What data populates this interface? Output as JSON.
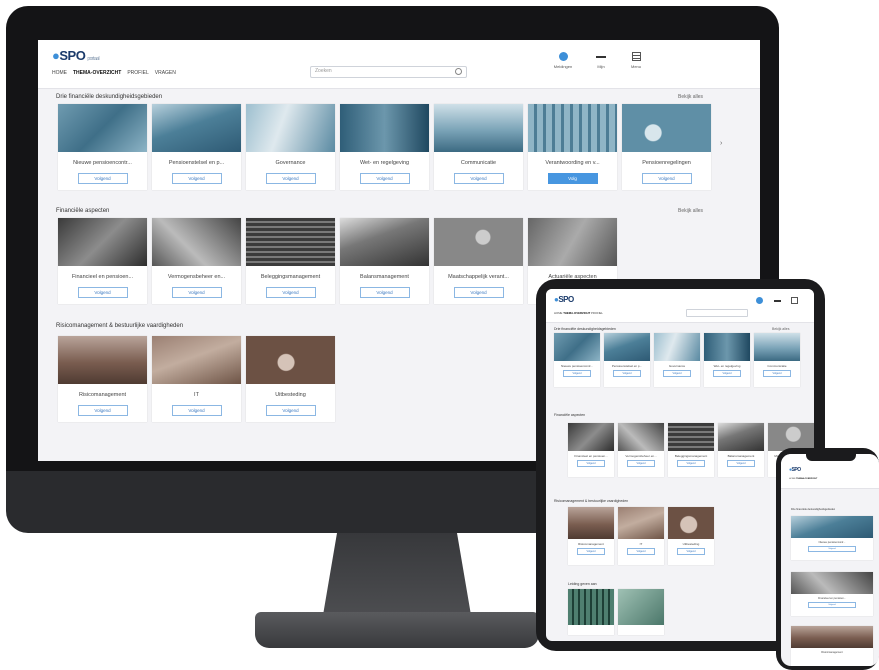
{
  "app": {
    "logo_text": "SPO",
    "logo_sub": "portaal"
  },
  "nav": [
    "HOME",
    "THEMA-OVERZICHT",
    "PROFIEL",
    "VRAGEN"
  ],
  "search": {
    "placeholder": "Zoeken"
  },
  "toolbar": {
    "notifications_label": "Meldingen",
    "profile_label": "Mijn",
    "menu_label": "Menu"
  },
  "sections": [
    {
      "title": "Drie financiële deskundigheidsgebieden",
      "more": "Bekijk alles",
      "cards": [
        {
          "caption": "Nieuwe pensioencontr...",
          "button": "Volgend"
        },
        {
          "caption": "Pensioenstelsel en p...",
          "button": "Volgend"
        },
        {
          "caption": "Governance",
          "button": "Volgend"
        },
        {
          "caption": "Wet- en regelgeving",
          "button": "Volgend"
        },
        {
          "caption": "Communicatie",
          "button": "Volgend"
        },
        {
          "caption": "Verantwoording en v...",
          "button": "Volg"
        },
        {
          "caption": "Pensioenregelingen",
          "button": "Volgend"
        }
      ]
    },
    {
      "title": "Financiële aspecten",
      "more": "Bekijk alles",
      "cards": [
        {
          "caption": "Financieel en pensioen...",
          "button": "Volgend"
        },
        {
          "caption": "Vermogensbeheer en...",
          "button": "Volgend"
        },
        {
          "caption": "Beleggingsmanagement",
          "button": "Volgend"
        },
        {
          "caption": "Balansmanagement",
          "button": "Volgend"
        },
        {
          "caption": "Maatschappelijk verant...",
          "button": "Volgend"
        },
        {
          "caption": "Actuariële aspecten",
          "button": "Volgend"
        }
      ]
    },
    {
      "title": "Risicomanagement & bestuurlijke vaardigheden",
      "more": "",
      "cards": [
        {
          "caption": "Risicomanagement",
          "button": "Volgend"
        },
        {
          "caption": "IT",
          "button": "Volgend"
        },
        {
          "caption": "Uitbesteding",
          "button": "Volgend"
        }
      ]
    }
  ],
  "tablet": {
    "section4_title": "Leiding geven aan"
  }
}
